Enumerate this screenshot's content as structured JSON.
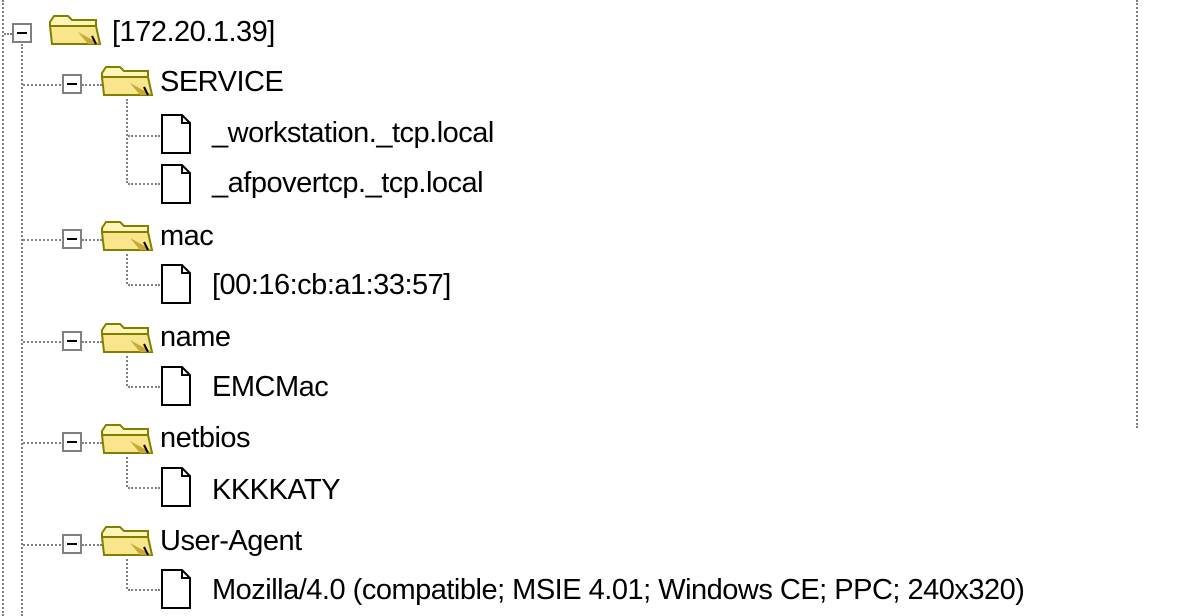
{
  "tree": {
    "root": {
      "label": "[172.20.1.39]",
      "icon": "folder-open-icon",
      "expanded": true
    },
    "groups": [
      {
        "label": "SERVICE",
        "icon": "folder-open-icon",
        "expanded": true,
        "children": [
          {
            "label": "_workstation._tcp.local",
            "icon": "document-icon"
          },
          {
            "label": "_afpovertcp._tcp.local",
            "icon": "document-icon"
          }
        ]
      },
      {
        "label": "mac",
        "icon": "folder-open-icon",
        "expanded": true,
        "children": [
          {
            "label": "[00:16:cb:a1:33:57]",
            "icon": "document-icon"
          }
        ]
      },
      {
        "label": "name",
        "icon": "folder-open-icon",
        "expanded": true,
        "children": [
          {
            "label": "EMCMac",
            "icon": "document-icon"
          }
        ]
      },
      {
        "label": "netbios",
        "icon": "folder-open-icon",
        "expanded": true,
        "children": [
          {
            "label": "KKKKATY",
            "icon": "document-icon"
          }
        ]
      },
      {
        "label": "User-Agent",
        "icon": "folder-open-icon",
        "expanded": true,
        "children": [
          {
            "label": "Mozilla/4.0 (compatible; MSIE 4.01; Windows CE; PPC; 240x320)",
            "icon": "document-icon"
          }
        ]
      }
    ]
  },
  "colors": {
    "folder_fill": "#f8e58c",
    "folder_shade": "#c8a838",
    "folder_outline": "#808000",
    "tree_lines": "#808080",
    "text": "#000000",
    "background": "#ffffff"
  }
}
